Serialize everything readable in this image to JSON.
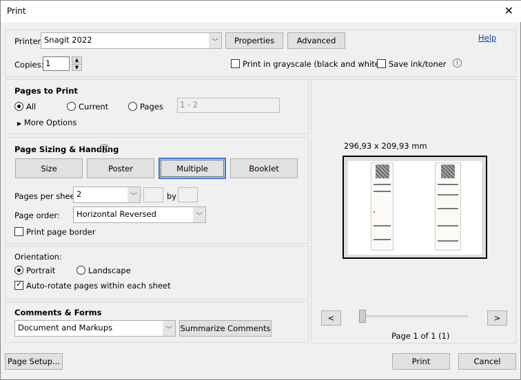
{
  "window": {
    "title": "Print",
    "close": "✕"
  },
  "printer": {
    "label": "Printer:",
    "value": "Snagit 2022",
    "properties": "Properties",
    "advanced": "Advanced",
    "help": "Help"
  },
  "copies": {
    "label": "Copies:",
    "value": "1"
  },
  "grayscale": {
    "label": "Print in grayscale (black and white)",
    "checked": false
  },
  "save_ink": {
    "label": "Save ink/toner",
    "checked": false
  },
  "pages_to_print": {
    "title": "Pages to Print",
    "all": "All",
    "current": "Current",
    "pages": "Pages",
    "pages_value": "1 - 2",
    "selected": "All",
    "more_options": "More Options"
  },
  "sizing": {
    "title": "Page Sizing & Handling",
    "tabs": [
      "Size",
      "Poster",
      "Multiple",
      "Booklet"
    ],
    "active": "Multiple",
    "pages_per_sheet_label": "Pages per sheet:",
    "pages_per_sheet": "2",
    "by": "by",
    "page_order_label": "Page order:",
    "page_order": "Horizontal Reversed",
    "border_label": "Print page border",
    "border_checked": false
  },
  "orientation": {
    "title": "Orientation:",
    "portrait": "Portrait",
    "landscape": "Landscape",
    "selected": "Portrait",
    "auto_rotate": "Auto-rotate pages within each sheet",
    "auto_rotate_checked": true
  },
  "comments": {
    "title": "Comments & Forms",
    "value": "Document and Markups",
    "summarize": "Summarize Comments"
  },
  "preview": {
    "size": "296,93 x 209,93 mm",
    "prev": "<",
    "next": ">",
    "page_status": "Page 1 of 1 (1)",
    "slider_value": 0
  },
  "footer": {
    "page_setup": "Page Setup...",
    "print": "Print",
    "cancel": "Cancel"
  }
}
